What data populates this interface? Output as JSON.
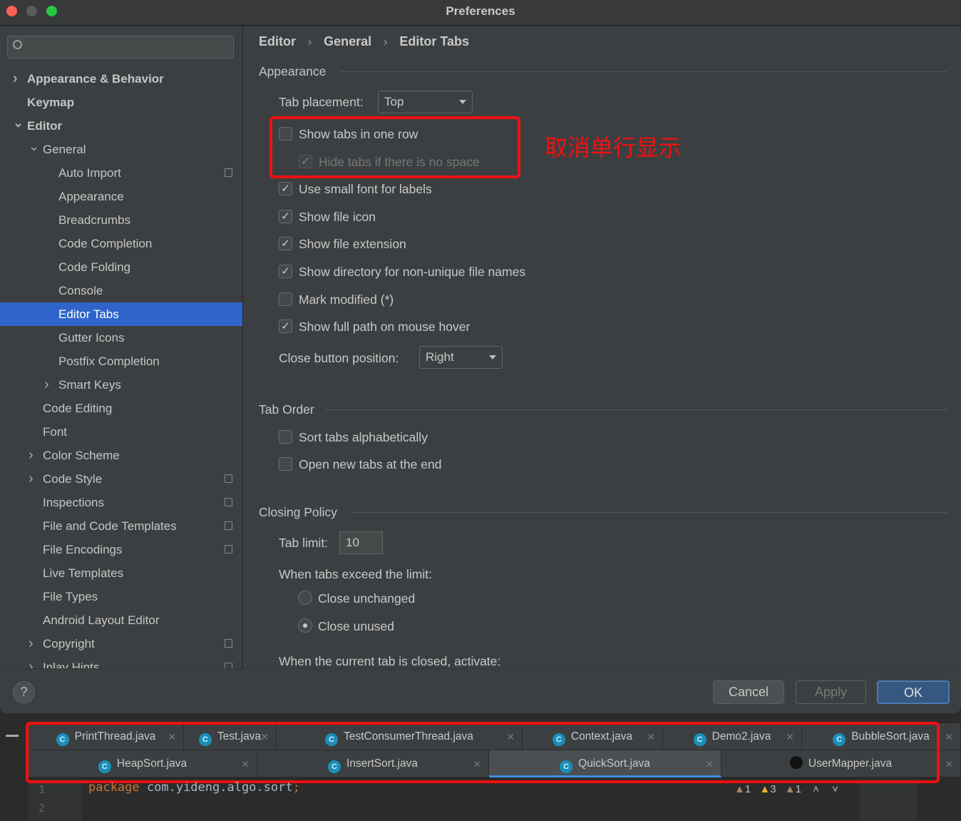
{
  "window": {
    "title": "Preferences"
  },
  "sidebar": {
    "search_placeholder": "",
    "items": [
      {
        "label": "Appearance & Behavior"
      },
      {
        "label": "Keymap"
      },
      {
        "label": "Editor"
      },
      {
        "label": "General"
      },
      {
        "label": "Auto Import"
      },
      {
        "label": "Appearance"
      },
      {
        "label": "Breadcrumbs"
      },
      {
        "label": "Code Completion"
      },
      {
        "label": "Code Folding"
      },
      {
        "label": "Console"
      },
      {
        "label": "Editor Tabs"
      },
      {
        "label": "Gutter Icons"
      },
      {
        "label": "Postfix Completion"
      },
      {
        "label": "Smart Keys"
      },
      {
        "label": "Code Editing"
      },
      {
        "label": "Font"
      },
      {
        "label": "Color Scheme"
      },
      {
        "label": "Code Style"
      },
      {
        "label": "Inspections"
      },
      {
        "label": "File and Code Templates"
      },
      {
        "label": "File Encodings"
      },
      {
        "label": "Live Templates"
      },
      {
        "label": "File Types"
      },
      {
        "label": "Android Layout Editor"
      },
      {
        "label": "Copyright"
      },
      {
        "label": "Inlay Hints"
      }
    ]
  },
  "breadcrumb": [
    "Editor",
    "General",
    "Editor Tabs"
  ],
  "appearance": {
    "title": "Appearance",
    "tab_placement_label": "Tab placement:",
    "tab_placement_value": "Top",
    "options": [
      {
        "label": "Show tabs in one row",
        "checked": false
      },
      {
        "label": "Hide tabs if there is no space",
        "checked": true,
        "disabled": true
      },
      {
        "label": "Use small font for labels",
        "checked": true
      },
      {
        "label": "Show file icon",
        "checked": true
      },
      {
        "label": "Show file extension",
        "checked": true
      },
      {
        "label": "Show directory for non-unique file names",
        "checked": true
      },
      {
        "label": "Mark modified (*)",
        "checked": false
      },
      {
        "label": "Show full path on mouse hover",
        "checked": true
      }
    ],
    "close_button_label": "Close button position:",
    "close_button_value": "Right"
  },
  "annotation": "取消单行显示",
  "tab_order": {
    "title": "Tab Order",
    "options": [
      {
        "label": "Sort tabs alphabetically",
        "checked": false
      },
      {
        "label": "Open new tabs at the end",
        "checked": false
      }
    ]
  },
  "closing_policy": {
    "title": "Closing Policy",
    "tab_limit_label": "Tab limit:",
    "tab_limit_value": "10",
    "exceed_label": "When tabs exceed the limit:",
    "radios": [
      {
        "label": "Close unchanged",
        "selected": false
      },
      {
        "label": "Close unused",
        "selected": true
      }
    ],
    "activate_label": "When the current tab is closed, activate:"
  },
  "footer": {
    "help": "?",
    "cancel": "Cancel",
    "apply": "Apply",
    "ok": "OK"
  },
  "editor": {
    "tabs_row1": [
      "PrintThread.java",
      "Test.java",
      "TestConsumerThread.java",
      "Context.java",
      "Demo2.java",
      "BubbleSort.java"
    ],
    "tabs_row2": [
      "HeapSort.java",
      "InsertSort.java",
      "QuickSort.java",
      "UserMapper.java"
    ],
    "active_tab": "QuickSort.java",
    "line_numbers": [
      "1",
      "2"
    ],
    "code_keyword": "package",
    "code_rest": " com.yideng.algo.sort",
    "code_semicolon": ";",
    "inspections": [
      {
        "icon": "warning-icon",
        "count": "1"
      },
      {
        "icon": "warning-icon",
        "count": "3"
      },
      {
        "icon": "warning-icon",
        "count": "1"
      }
    ]
  },
  "colors": {
    "accent": "#2f65ca",
    "annotation": "#ee1111"
  }
}
